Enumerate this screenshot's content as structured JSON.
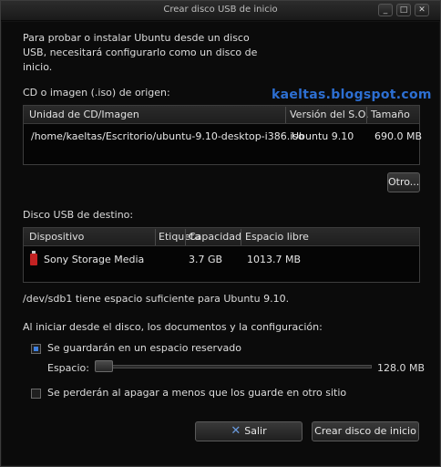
{
  "window": {
    "title": "Crear disco USB de inicio",
    "controls": {
      "minimize": "_",
      "maximize": "□",
      "close": "✕"
    }
  },
  "intro": "Para probar o instalar Ubuntu desde un disco USB, necesitará configurarlo como un disco de inicio.",
  "watermark": "kaeltas.blogspot.com",
  "source": {
    "label": "CD o imagen (.iso) de origen:",
    "columns": [
      "Unidad de CD/Imagen",
      "Versión del S.O.",
      "Tamaño"
    ],
    "rows": [
      {
        "path": "/home/kaeltas/Escritorio/ubuntu-9.10-desktop-i386.iso",
        "version": "Ubuntu 9.10",
        "size": "690.0 MB"
      }
    ],
    "other_button": "Otro..."
  },
  "target": {
    "label": "Disco USB de destino:",
    "columns": [
      "Dispositivo",
      "Etiqueta",
      "Capacidad",
      "Espacio libre"
    ],
    "rows": [
      {
        "device": "Sony Storage Media",
        "label": "",
        "capacity": "3.7 GB",
        "free": "1013.7 MB"
      }
    ],
    "status": "/dev/sdb1 tiene espacio suficiente para Ubuntu 9.10."
  },
  "persistence": {
    "label": "Al iniciar desde el disco, los documentos y la configuración:",
    "option_keep": "Se guardarán en un espacio reservado",
    "option_keep_selected": true,
    "space_label": "Espacio:",
    "space_value": "128.0 MB",
    "option_discard": "Se perderán al apagar a menos que los guarde en otro sitio"
  },
  "buttons": {
    "quit": "Salir",
    "create": "Crear disco de inicio"
  },
  "colors": {
    "watermark": "#2d6fd2",
    "usb_icon": "#c32222",
    "radio_selected": "#3e80e0"
  }
}
